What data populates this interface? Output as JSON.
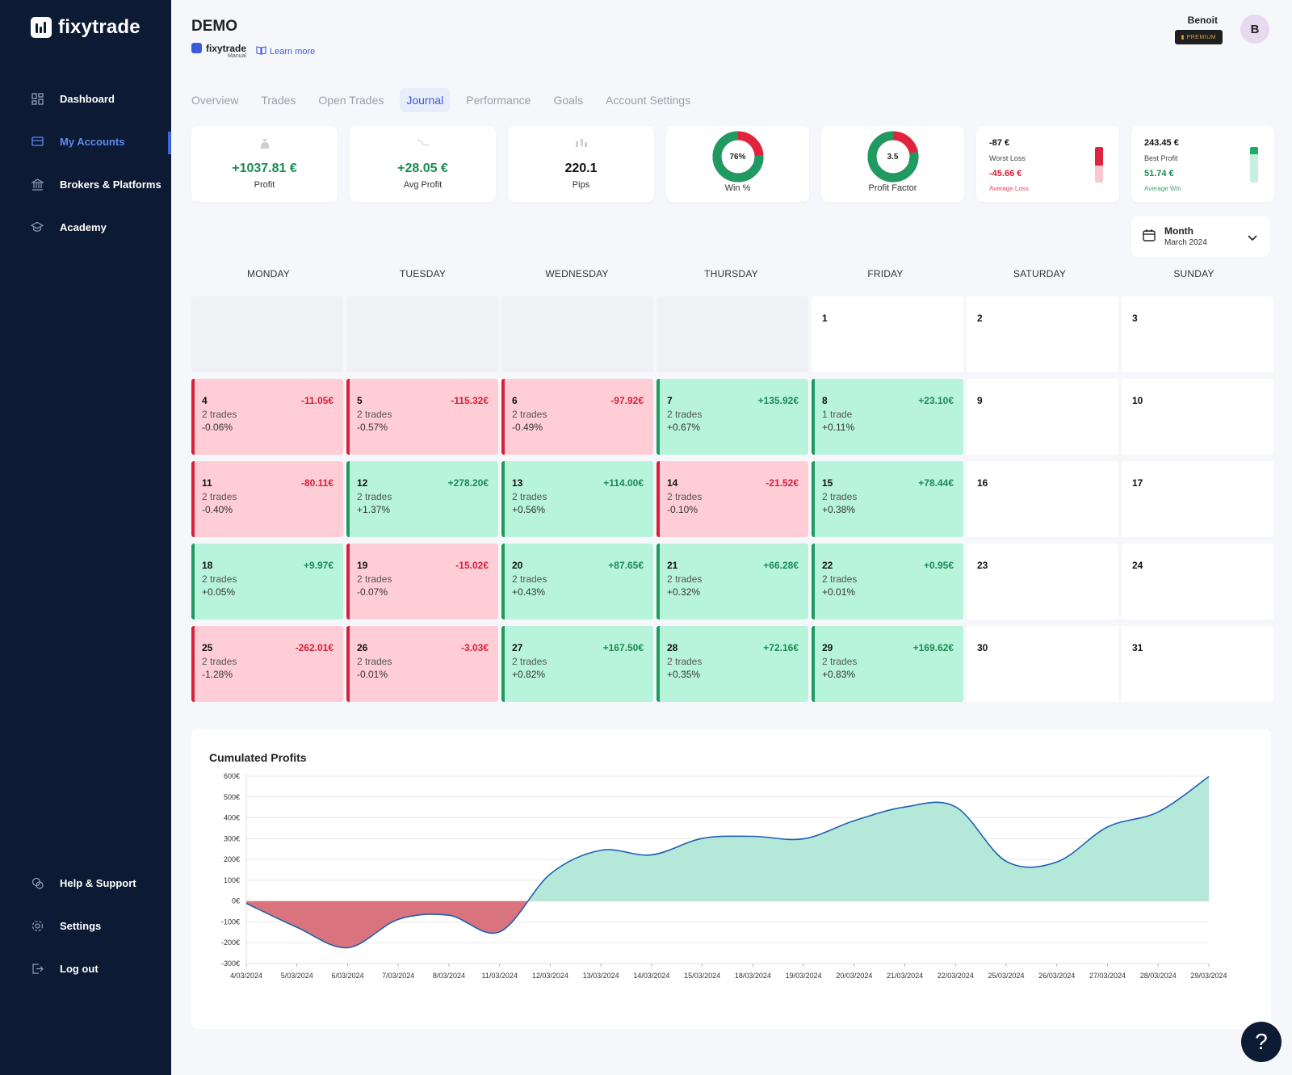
{
  "brand": {
    "name": "fixytrade",
    "sub_name": "fixytrade",
    "sub_caption": "Manual"
  },
  "sidebar": {
    "items": [
      {
        "label": "Dashboard",
        "icon": "grid-icon"
      },
      {
        "label": "My Accounts",
        "icon": "card-icon",
        "active": true
      },
      {
        "label": "Brokers & Platforms",
        "icon": "bank-icon"
      },
      {
        "label": "Academy",
        "icon": "graduation-cap-icon"
      }
    ],
    "bottom_items": [
      {
        "label": "Help & Support",
        "icon": "chat-icon"
      },
      {
        "label": "Settings",
        "icon": "gear-icon"
      },
      {
        "label": "Log out",
        "icon": "logout-icon"
      }
    ]
  },
  "header": {
    "title": "DEMO",
    "learn_more": "Learn more",
    "user_name": "Benoit",
    "badge": "PREMIUM",
    "avatar_initial": "B"
  },
  "tabs": [
    "Overview",
    "Trades",
    "Open Trades",
    "Journal",
    "Performance",
    "Goals",
    "Account Settings"
  ],
  "active_tab": "Journal",
  "stats": {
    "profit": {
      "value": "+1037.81 €",
      "label": "Profit"
    },
    "avg_profit": {
      "value": "+28.05 €",
      "label": "Avg Profit"
    },
    "pips": {
      "value": "220.1",
      "label": "Pips"
    },
    "win": {
      "value": "76%",
      "label": "Win %",
      "fraction": 0.76
    },
    "profit_factor": {
      "value": "3.5",
      "label": "Profit Factor",
      "fraction": 0.78
    },
    "worst": {
      "worst_loss": "-87 €",
      "worst_loss_label": "Worst Loss",
      "avg_loss": "-45.66 €",
      "avg_loss_label": "Average Loss",
      "fill": 0.52
    },
    "best": {
      "best_profit": "243.45 €",
      "best_profit_label": "Best Profit",
      "avg_win": "51.74 €",
      "avg_win_label": "Average Win",
      "fill": 0.21
    }
  },
  "month_picker": {
    "label": "Month",
    "value": "March 2024"
  },
  "weekdays": [
    "MONDAY",
    "TUESDAY",
    "WEDNESDAY",
    "THURSDAY",
    "FRIDAY",
    "SATURDAY",
    "SUNDAY"
  ],
  "calendar": [
    {
      "day": "",
      "type": "empty"
    },
    {
      "day": "",
      "type": "empty"
    },
    {
      "day": "",
      "type": "empty"
    },
    {
      "day": "",
      "type": "empty"
    },
    {
      "day": "1"
    },
    {
      "day": "2"
    },
    {
      "day": "3"
    },
    {
      "day": "4",
      "type": "loss",
      "pnl": "-11.05€",
      "trades": "2 trades",
      "pct": "-0.06%"
    },
    {
      "day": "5",
      "type": "loss",
      "pnl": "-115.32€",
      "trades": "2 trades",
      "pct": "-0.57%"
    },
    {
      "day": "6",
      "type": "loss",
      "pnl": "-97.92€",
      "trades": "2 trades",
      "pct": "-0.49%"
    },
    {
      "day": "7",
      "type": "win",
      "pnl": "+135.92€",
      "trades": "2 trades",
      "pct": "+0.67%"
    },
    {
      "day": "8",
      "type": "win",
      "pnl": "+23.10€",
      "trades": "1 trade",
      "pct": "+0.11%"
    },
    {
      "day": "9"
    },
    {
      "day": "10"
    },
    {
      "day": "11",
      "type": "loss",
      "pnl": "-80.11€",
      "trades": "2 trades",
      "pct": "-0.40%"
    },
    {
      "day": "12",
      "type": "win",
      "pnl": "+278.20€",
      "trades": "2 trades",
      "pct": "+1.37%"
    },
    {
      "day": "13",
      "type": "win",
      "pnl": "+114.00€",
      "trades": "2 trades",
      "pct": "+0.56%"
    },
    {
      "day": "14",
      "type": "loss",
      "pnl": "-21.52€",
      "trades": "2 trades",
      "pct": "-0.10%"
    },
    {
      "day": "15",
      "type": "win",
      "pnl": "+78.44€",
      "trades": "2 trades",
      "pct": "+0.38%"
    },
    {
      "day": "16"
    },
    {
      "day": "17"
    },
    {
      "day": "18",
      "type": "win",
      "pnl": "+9.97€",
      "trades": "2 trades",
      "pct": "+0.05%"
    },
    {
      "day": "19",
      "type": "loss",
      "pnl": "-15.02€",
      "trades": "2 trades",
      "pct": "-0.07%"
    },
    {
      "day": "20",
      "type": "win",
      "pnl": "+87.65€",
      "trades": "2 trades",
      "pct": "+0.43%"
    },
    {
      "day": "21",
      "type": "win",
      "pnl": "+66.28€",
      "trades": "2 trades",
      "pct": "+0.32%"
    },
    {
      "day": "22",
      "type": "win",
      "pnl": "+0.95€",
      "trades": "2 trades",
      "pct": "+0.01%"
    },
    {
      "day": "23"
    },
    {
      "day": "24"
    },
    {
      "day": "25",
      "type": "loss",
      "pnl": "-262.01€",
      "trades": "2 trades",
      "pct": "-1.28%"
    },
    {
      "day": "26",
      "type": "loss",
      "pnl": "-3.03€",
      "trades": "2 trades",
      "pct": "-0.01%"
    },
    {
      "day": "27",
      "type": "win",
      "pnl": "+167.50€",
      "trades": "2 trades",
      "pct": "+0.82%"
    },
    {
      "day": "28",
      "type": "win",
      "pnl": "+72.16€",
      "trades": "2 trades",
      "pct": "+0.35%"
    },
    {
      "day": "29",
      "type": "win",
      "pnl": "+169.62€",
      "trades": "2 trades",
      "pct": "+0.83%"
    },
    {
      "day": "30"
    },
    {
      "day": "31"
    }
  ],
  "colors": {
    "sidebar": "#0c1a33",
    "accent": "#3b5bd9",
    "profit": "#1a8a55",
    "loss": "#d6203c",
    "area_pos": "#b4e8d8",
    "area_neg": "#d9747e",
    "line": "#1e5fb3"
  },
  "chart_data": {
    "type": "area",
    "title": "Cumulated Profits",
    "x": [
      "4/03/2024",
      "5/03/2024",
      "6/03/2024",
      "7/03/2024",
      "8/03/2024",
      "11/03/2024",
      "12/03/2024",
      "13/03/2024",
      "14/03/2024",
      "15/03/2024",
      "18/03/2024",
      "19/03/2024",
      "20/03/2024",
      "21/03/2024",
      "22/03/2024",
      "25/03/2024",
      "26/03/2024",
      "27/03/2024",
      "28/03/2024",
      "29/03/2024"
    ],
    "values": [
      -11,
      -126,
      -224,
      -88,
      -68,
      -148,
      130,
      244,
      222,
      301,
      311,
      299,
      386,
      452,
      453,
      191,
      188,
      356,
      428,
      598
    ],
    "y_ticks": [
      "600€",
      "500€",
      "400€",
      "300€",
      "200€",
      "100€",
      "0€",
      "-100€",
      "-200€",
      "-300€"
    ],
    "ylim": [
      -300,
      600
    ],
    "grid": true
  }
}
